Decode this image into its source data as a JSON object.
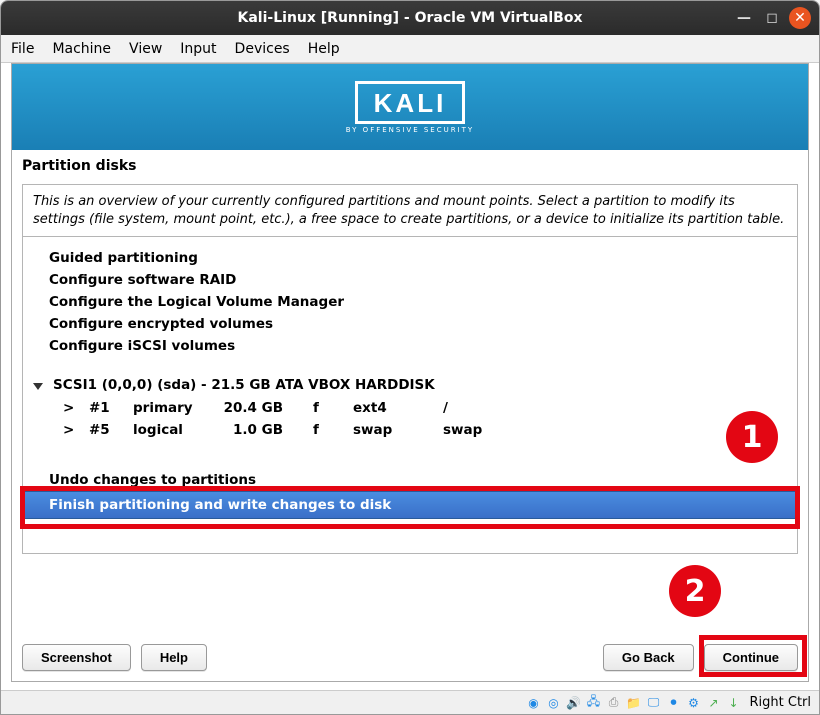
{
  "window": {
    "title": "Kali-Linux [Running] - Oracle VM VirtualBox"
  },
  "menubar": {
    "items": [
      "File",
      "Machine",
      "View",
      "Input",
      "Devices",
      "Help"
    ]
  },
  "banner": {
    "logo_text": "KALI",
    "logo_sub": "BY OFFENSIVE SECURITY"
  },
  "page": {
    "title": "Partition disks",
    "intro": "This is an overview of your currently configured partitions and mount points. Select a partition to modify its settings (file system, mount point, etc.), a free space to create partitions, or a device to initialize its partition table."
  },
  "config_options": {
    "items": [
      "Guided partitioning",
      "Configure software RAID",
      "Configure the Logical Volume Manager",
      "Configure encrypted volumes",
      "Configure iSCSI volumes"
    ]
  },
  "disk": {
    "header": "SCSI1 (0,0,0) (sda) - 21.5 GB ATA VBOX HARDDISK",
    "partitions": [
      {
        "arrow": ">",
        "num": "#1",
        "type": "primary",
        "size": "20.4 GB",
        "flag": "f",
        "fs": "ext4",
        "mount": "/"
      },
      {
        "arrow": ">",
        "num": "#5",
        "type": "logical",
        "size": "1.0 GB",
        "flag": "f",
        "fs": "swap",
        "mount": "swap"
      }
    ]
  },
  "actions": {
    "undo": "Undo changes to partitions",
    "finish": "Finish partitioning and write changes to disk"
  },
  "buttons": {
    "screenshot": "Screenshot",
    "help": "Help",
    "goback": "Go Back",
    "continue": "Continue"
  },
  "statusbar": {
    "hostkey": "Right Ctrl"
  },
  "annotations": {
    "badge1": "1",
    "badge2": "2"
  }
}
